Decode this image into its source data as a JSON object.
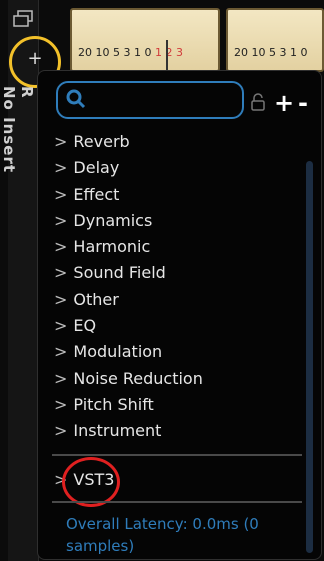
{
  "sidebar": {
    "add_label": "+",
    "vertical_label": "No Insert",
    "vertical_prefix": "R"
  },
  "meters": [
    {
      "scale_left": "20 10 5 3 1 0",
      "scale_right": "1 2 3"
    },
    {
      "scale_left": "20 10 5 3 1 0",
      "scale_right": ""
    }
  ],
  "search": {
    "placeholder": ""
  },
  "toolbar": {
    "plus_label": "+",
    "minus_label": "-"
  },
  "categories": [
    "Reverb",
    "Delay",
    "Effect",
    "Dynamics",
    "Harmonic",
    "Sound Field",
    "Other",
    "EQ",
    "Modulation",
    "Noise Reduction",
    "Pitch Shift",
    "Instrument"
  ],
  "chevron": ">",
  "vst_section": {
    "label": "VST3"
  },
  "footer": {
    "latency_text": "Overall Latency: 0.0ms (0 samples)"
  },
  "colors": {
    "accent": "#2f7dbb",
    "highlight_yellow": "#f3c12a",
    "highlight_red": "#e02020"
  }
}
